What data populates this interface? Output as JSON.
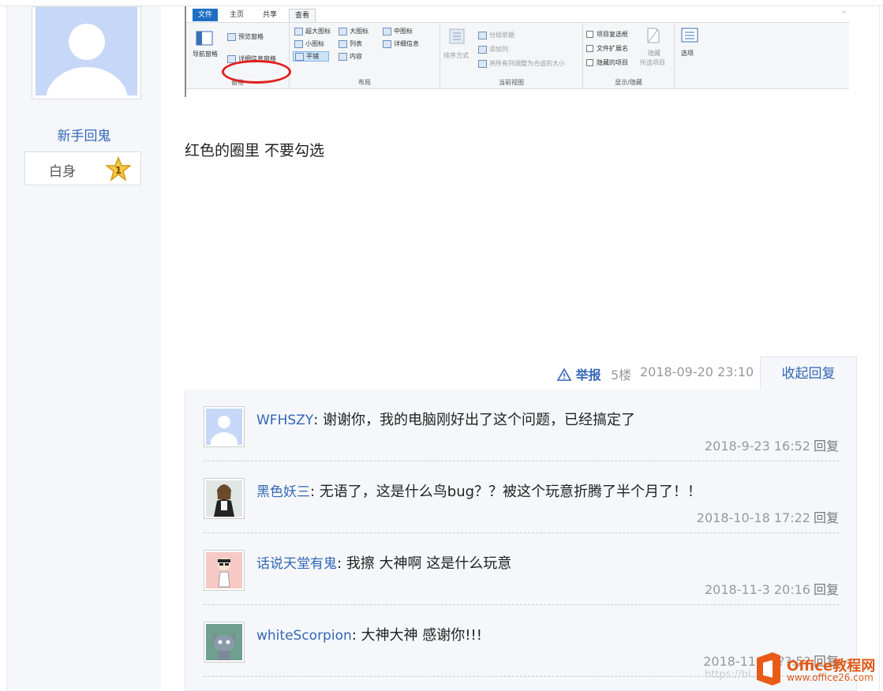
{
  "user": {
    "name": "新手回鬼",
    "rank_label": "白身",
    "rank_level": "1"
  },
  "screenshot": {
    "tabs": [
      "文件",
      "主页",
      "共享",
      "查看"
    ],
    "panes": {
      "nav_pane": "导航窗格",
      "preview_pane": "预览窗格",
      "details_pane": "详细信息窗格",
      "group_label": "窗格"
    },
    "layout": {
      "items": [
        "超大图标",
        "大图标",
        "中图标",
        "小图标",
        "列表",
        "详细信息",
        "平铺",
        "内容"
      ],
      "group_label": "布局"
    },
    "current_view": {
      "sort": "排序方式",
      "group_by": "分组依据",
      "add_column": "添加列",
      "fit_columns": "将所有列调整为合适的大小",
      "group_label": "当前视图"
    },
    "show_hide": {
      "item_checkbox": "项目复选框",
      "file_ext": "文件扩展名",
      "hidden_items": "隐藏的项目",
      "hide_selected_1": "隐藏",
      "hide_selected_2": "所选项目",
      "group_label": "显示/隐藏"
    },
    "options": "选项"
  },
  "post": {
    "text": "红色的圈里 不要勾选"
  },
  "actions": {
    "report": "举报",
    "floor": "5楼",
    "time": "2018-09-20 23:10",
    "collapse": "收起回复"
  },
  "replies": [
    {
      "name": "WFHSZY",
      "text": "谢谢你，我的电脑刚好出了这个问题，已经搞定了",
      "time": "2018-9-23 16:52",
      "reply": "回复"
    },
    {
      "name": "黑色妖三",
      "text": "无语了，这是什么鸟bug？？被这个玩意折腾了半个月了！！",
      "time": "2018-10-18 17:22",
      "reply": "回复"
    },
    {
      "name": "话说天堂有鬼",
      "text": "我擦 大神啊 这是什么玩意",
      "time": "2018-11-3 20:16",
      "reply": "回复"
    },
    {
      "name": "whiteScorpion",
      "text": "大神大神 感谢你!!!",
      "time": "2018-11-?? ??:5?",
      "reply": "回复"
    }
  ],
  "watermark": {
    "brand": "Office教程网",
    "site": "www.office26.com",
    "url_fragment": "https://bl..."
  },
  "colors": {
    "link": "#3467b6",
    "meta": "#999999",
    "panel": "#f5f7fa",
    "accent_red": "#e02020"
  }
}
